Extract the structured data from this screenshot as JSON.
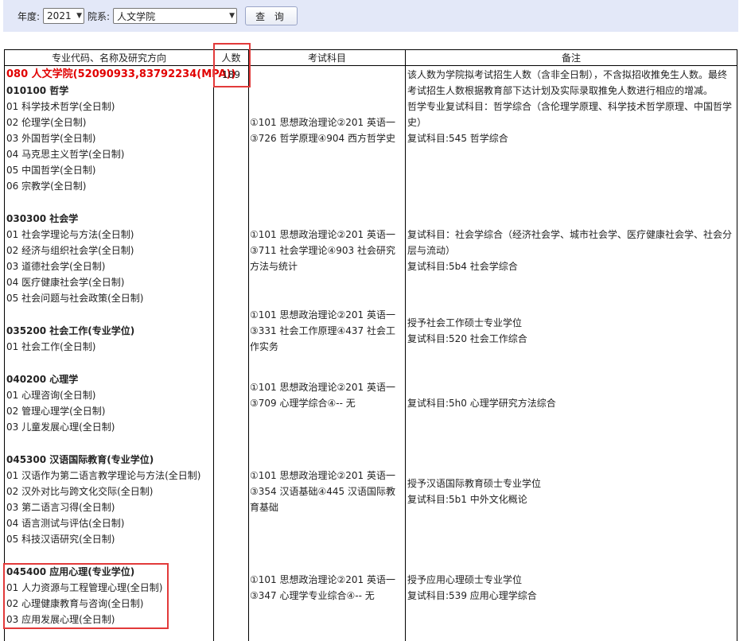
{
  "filters": {
    "year_label": "年度:",
    "year_value": "2021",
    "dept_label": "院系:",
    "dept_value": "人文学院",
    "query_button": "查 询"
  },
  "table": {
    "headers": [
      "专业代码、名称及研究方向",
      "人数",
      "考试科目",
      "备注"
    ],
    "college": {
      "name": "080 人文学院(52090933,83792234(MPA))",
      "count": "189",
      "note": "该人数为学院拟考试招生人数（含非全日制），不含拟招收推免生人数。最终考试招生人数根据教育部下达计划及实际录取推免人数进行相应的增减。"
    },
    "programs": [
      {
        "code": "010100 哲学",
        "directions": [
          "01 科学技术哲学(全日制)",
          "02 伦理学(全日制)",
          "03 外国哲学(全日制)",
          "04 马克思主义哲学(全日制)",
          "05 中国哲学(全日制)",
          "06 宗教学(全日制)"
        ],
        "exam": "①101 思想政治理论②201 英语一③726 哲学原理④904 西方哲学史",
        "note": [
          "哲学专业复试科目：哲学综合（含伦理学原理、科学技术哲学原理、中国哲学史）",
          "复试科目:545 哲学综合"
        ]
      },
      {
        "code": "030300 社会学",
        "directions": [
          "01 社会学理论与方法(全日制)",
          "02 经济与组织社会学(全日制)",
          "03 道德社会学(全日制)",
          "04 医疗健康社会学(全日制)",
          "05 社会问题与社会政策(全日制)"
        ],
        "exam": "①101 思想政治理论②201 英语一③711 社会学理论④903 社会研究方法与统计",
        "note": [
          "复试科目：社会学综合（经济社会学、城市社会学、医疗健康社会学、社会分层与流动）",
          "复试科目:5b4 社会学综合"
        ]
      },
      {
        "code": "035200 社会工作(专业学位)",
        "directions": [
          "01 社会工作(全日制)"
        ],
        "exam": "①101 思想政治理论②201 英语一③331 社会工作原理④437 社会工作实务",
        "note": [
          "授予社会工作硕士专业学位",
          "复试科目:520 社会工作综合"
        ]
      },
      {
        "code": "040200 心理学",
        "directions": [
          "01 心理咨询(全日制)",
          "02 管理心理学(全日制)",
          "03 儿童发展心理(全日制)"
        ],
        "exam": "①101 思想政治理论②201 英语一③709 心理学综合④-- 无",
        "note": [
          "复试科目:5h0 心理学研究方法综合"
        ]
      },
      {
        "code": "045300 汉语国际教育(专业学位)",
        "directions": [
          "01 汉语作为第二语言教学理论与方法(全日制)",
          "02 汉外对比与跨文化交际(全日制)",
          "03 第二语言习得(全日制)",
          "04 语言测试与评估(全日制)",
          "05 科技汉语研究(全日制)"
        ],
        "exam": "①101 思想政治理论②201 英语一③354 汉语基础④445 汉语国际教育基础",
        "note": [
          "授予汉语国际教育硕士专业学位",
          "复试科目:5b1 中外文化概论"
        ]
      },
      {
        "code": "045400 应用心理(专业学位)",
        "directions": [
          "01 人力资源与工程管理心理(全日制)",
          "02 心理健康教育与咨询(全日制)",
          "03 应用发展心理(全日制)"
        ],
        "exam": "①101 思想政治理论②201 英语一③347 心理学专业综合④-- 无",
        "note": [
          "授予应用心理硕士专业学位",
          "复试科目:539 应用心理学综合"
        ]
      }
    ]
  }
}
